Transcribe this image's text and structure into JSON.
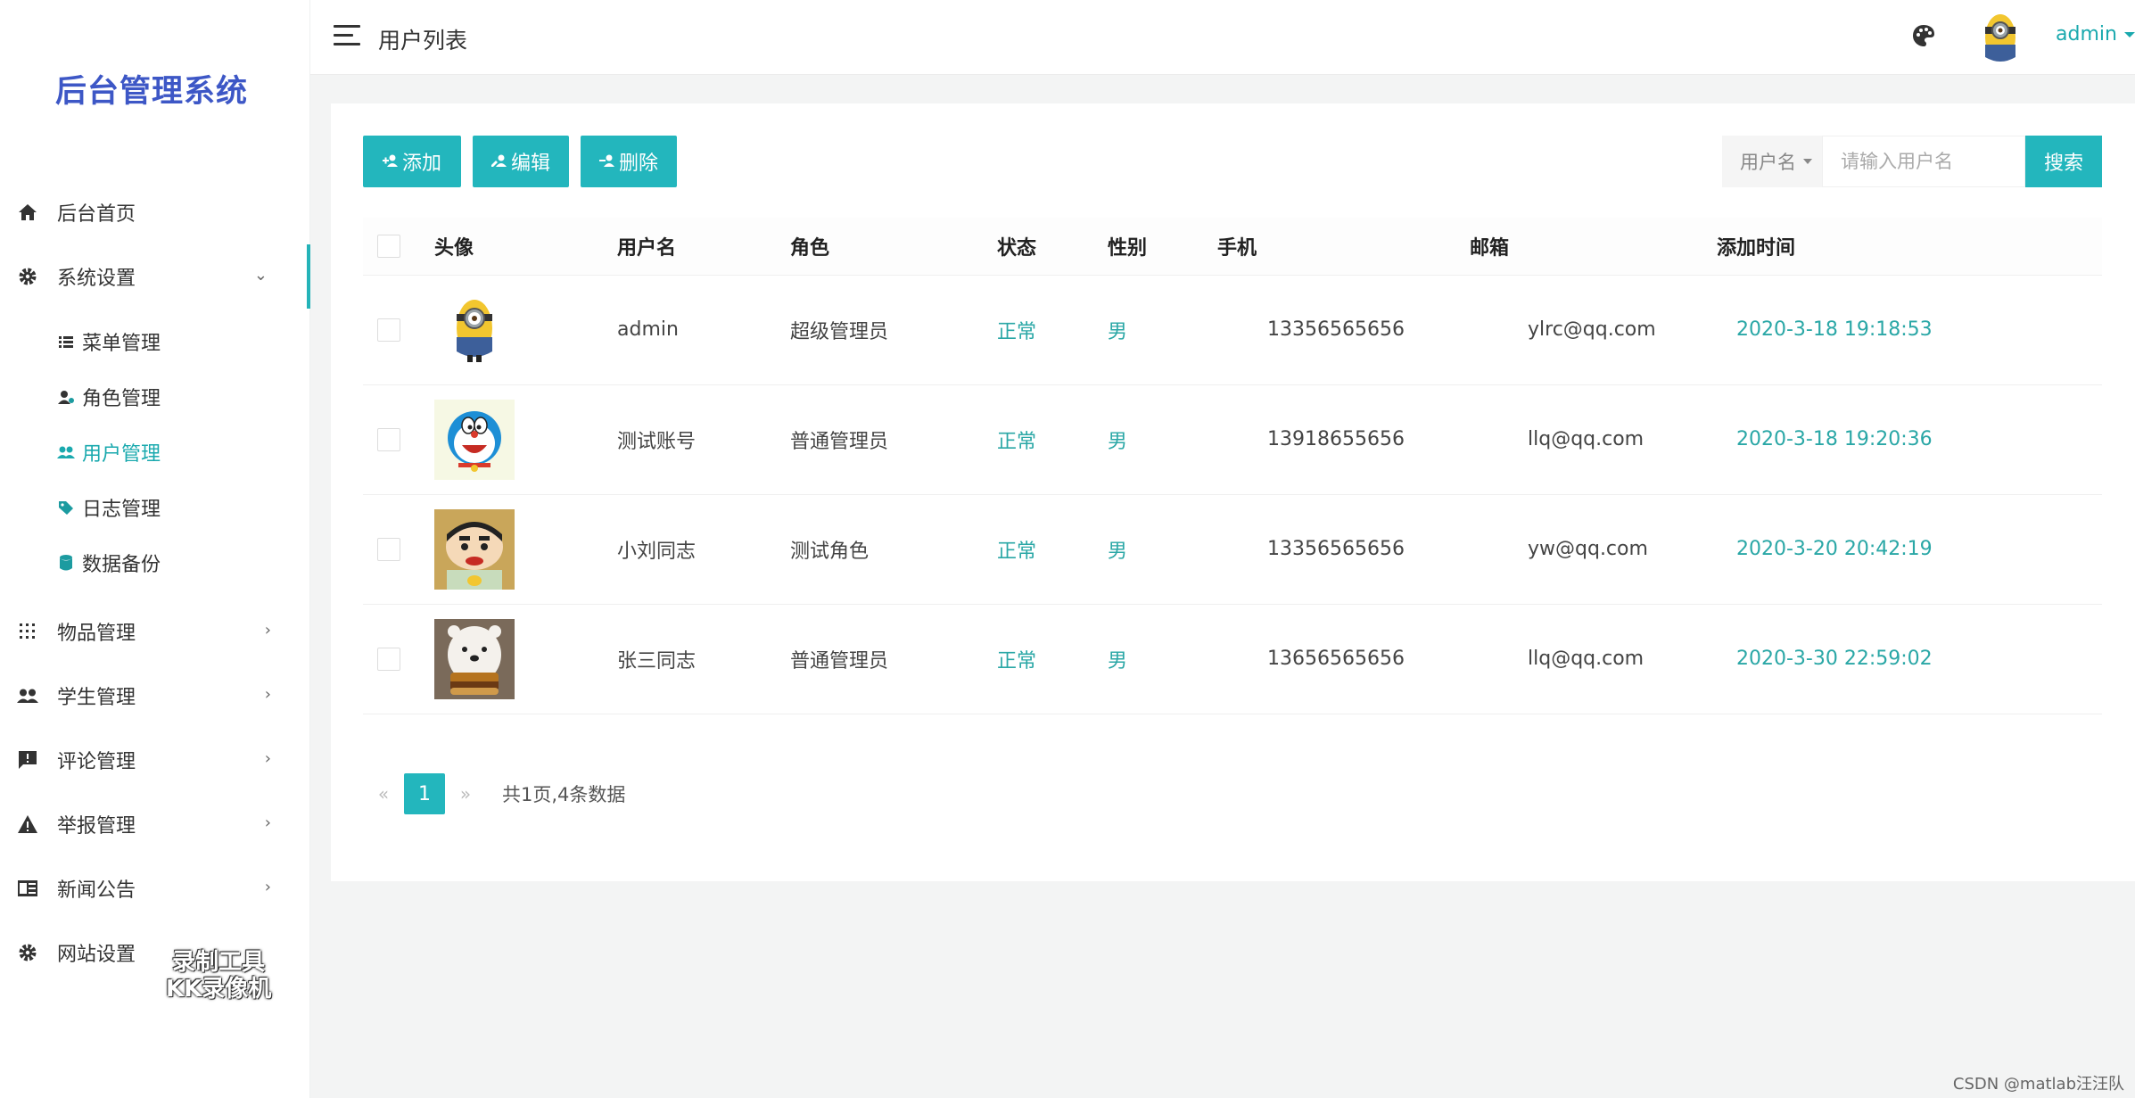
{
  "sidebar": {
    "brand": "后台管理系统",
    "items": [
      {
        "label": "后台首页",
        "icon": "home-icon"
      },
      {
        "label": "系统设置",
        "icon": "gear-icon",
        "open": true
      },
      {
        "label": "物品管理",
        "icon": "grid-icon"
      },
      {
        "label": "学生管理",
        "icon": "users-icon"
      },
      {
        "label": "评论管理",
        "icon": "comment-icon"
      },
      {
        "label": "举报管理",
        "icon": "warning-icon"
      },
      {
        "label": "新闻公告",
        "icon": "news-icon"
      },
      {
        "label": "网站设置",
        "icon": "gear-icon"
      }
    ],
    "submenu": [
      {
        "label": "菜单管理",
        "icon": "list-icon"
      },
      {
        "label": "角色管理",
        "icon": "user-role-icon"
      },
      {
        "label": "用户管理",
        "icon": "users-icon",
        "active": true
      },
      {
        "label": "日志管理",
        "icon": "tag-icon"
      },
      {
        "label": "数据备份",
        "icon": "database-icon"
      }
    ],
    "watermark_line1": "录制工具",
    "watermark_line2": "KK录像机"
  },
  "header": {
    "title": "用户列表",
    "username": "admin"
  },
  "toolbar": {
    "add_label": "添加",
    "edit_label": "编辑",
    "delete_label": "删除",
    "search_field": "用户名",
    "search_placeholder": "请输入用户名",
    "search_label": "搜索"
  },
  "table": {
    "columns": [
      "头像",
      "用户名",
      "角色",
      "状态",
      "性别",
      "手机",
      "邮箱",
      "添加时间"
    ],
    "rows": [
      {
        "avatar": "minion",
        "username": "admin",
        "role": "超级管理员",
        "status": "正常",
        "gender": "男",
        "phone": "13356565656",
        "email": "ylrc@qq.com",
        "created": "2020-3-18 19:18:53"
      },
      {
        "avatar": "doraemon",
        "username": "测试账号",
        "role": "普通管理员",
        "status": "正常",
        "gender": "男",
        "phone": "13918655656",
        "email": "llq@qq.com",
        "created": "2020-3-18 19:20:36"
      },
      {
        "avatar": "shinchan",
        "username": "小刘同志",
        "role": "测试角色",
        "status": "正常",
        "gender": "男",
        "phone": "13356565656",
        "email": "yw@qq.com",
        "created": "2020-3-20 20:42:19"
      },
      {
        "avatar": "polar-bear",
        "username": "张三同志",
        "role": "普通管理员",
        "status": "正常",
        "gender": "男",
        "phone": "13656565656",
        "email": "llq@qq.com",
        "created": "2020-3-30 22:59:02"
      }
    ]
  },
  "pager": {
    "prev": "«",
    "current": "1",
    "next": "»",
    "summary": "共1页,4条数据"
  },
  "footer": {
    "credit": "CSDN @matlab汪汪队"
  },
  "colors": {
    "accent": "#23b6bd",
    "brand": "#3d57c6",
    "teal_text": "#2aa7a6"
  }
}
